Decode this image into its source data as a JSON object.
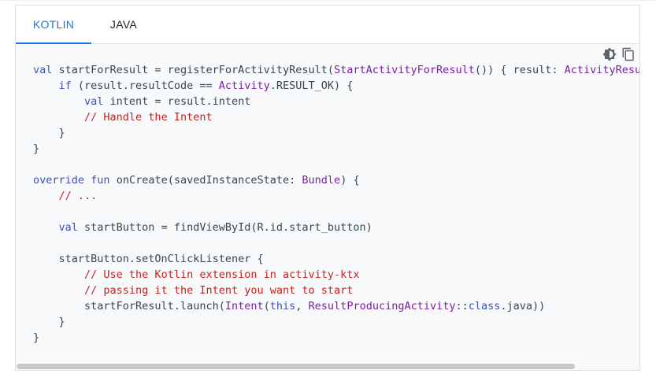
{
  "tabs": [
    {
      "label": "KOTLIN",
      "active": true
    },
    {
      "label": "JAVA",
      "active": false
    }
  ],
  "toolbar": {
    "theme_icon": "dark-mode-toggle-icon",
    "copy_icon": "copy-icon"
  },
  "colors": {
    "accent": "#1a73e8",
    "keyword": "#3f51b5",
    "type": "#7b1fa2",
    "comment": "#c5221f",
    "text": "#37474f"
  },
  "code_lines": [
    [
      [
        "kw",
        "val"
      ],
      [
        "tx",
        " startForResult = registerForActivityResult("
      ],
      [
        "ty",
        "StartActivityForResult"
      ],
      [
        "tx",
        "()) { result: "
      ],
      [
        "ty",
        "ActivityResult"
      ]
    ],
    [
      [
        "tx",
        "    "
      ],
      [
        "kw",
        "if"
      ],
      [
        "tx",
        " (result.resultCode == "
      ],
      [
        "ty",
        "Activity"
      ],
      [
        "tx",
        ".RESULT_OK) {"
      ]
    ],
    [
      [
        "tx",
        "        "
      ],
      [
        "kw",
        "val"
      ],
      [
        "tx",
        " intent = result.intent"
      ]
    ],
    [
      [
        "tx",
        "        "
      ],
      [
        "cm",
        "// Handle the Intent"
      ]
    ],
    [
      [
        "tx",
        "    }"
      ]
    ],
    [
      [
        "tx",
        "}"
      ]
    ],
    [],
    [
      [
        "kw",
        "override"
      ],
      [
        "tx",
        " "
      ],
      [
        "kw",
        "fun"
      ],
      [
        "tx",
        " onCreate(savedInstanceState: "
      ],
      [
        "ty",
        "Bundle"
      ],
      [
        "tx",
        ") {"
      ]
    ],
    [
      [
        "tx",
        "    "
      ],
      [
        "cm",
        "// ..."
      ]
    ],
    [],
    [
      [
        "tx",
        "    "
      ],
      [
        "kw",
        "val"
      ],
      [
        "tx",
        " startButton = findViewById(R.id.start_button)"
      ]
    ],
    [],
    [
      [
        "tx",
        "    startButton.setOnClickListener {"
      ]
    ],
    [
      [
        "tx",
        "        "
      ],
      [
        "cm",
        "// Use the Kotlin extension in activity-ktx"
      ]
    ],
    [
      [
        "tx",
        "        "
      ],
      [
        "cm",
        "// passing it the Intent you want to start"
      ]
    ],
    [
      [
        "tx",
        "        startForResult.launch("
      ],
      [
        "ty",
        "Intent"
      ],
      [
        "tx",
        "("
      ],
      [
        "kw",
        "this"
      ],
      [
        "tx",
        ", "
      ],
      [
        "ty",
        "ResultProducingActivity"
      ],
      [
        "tx",
        "::"
      ],
      [
        "kw",
        "class"
      ],
      [
        "tx",
        ".java))"
      ]
    ],
    [
      [
        "tx",
        "    }"
      ]
    ],
    [
      [
        "tx",
        "}"
      ]
    ]
  ]
}
